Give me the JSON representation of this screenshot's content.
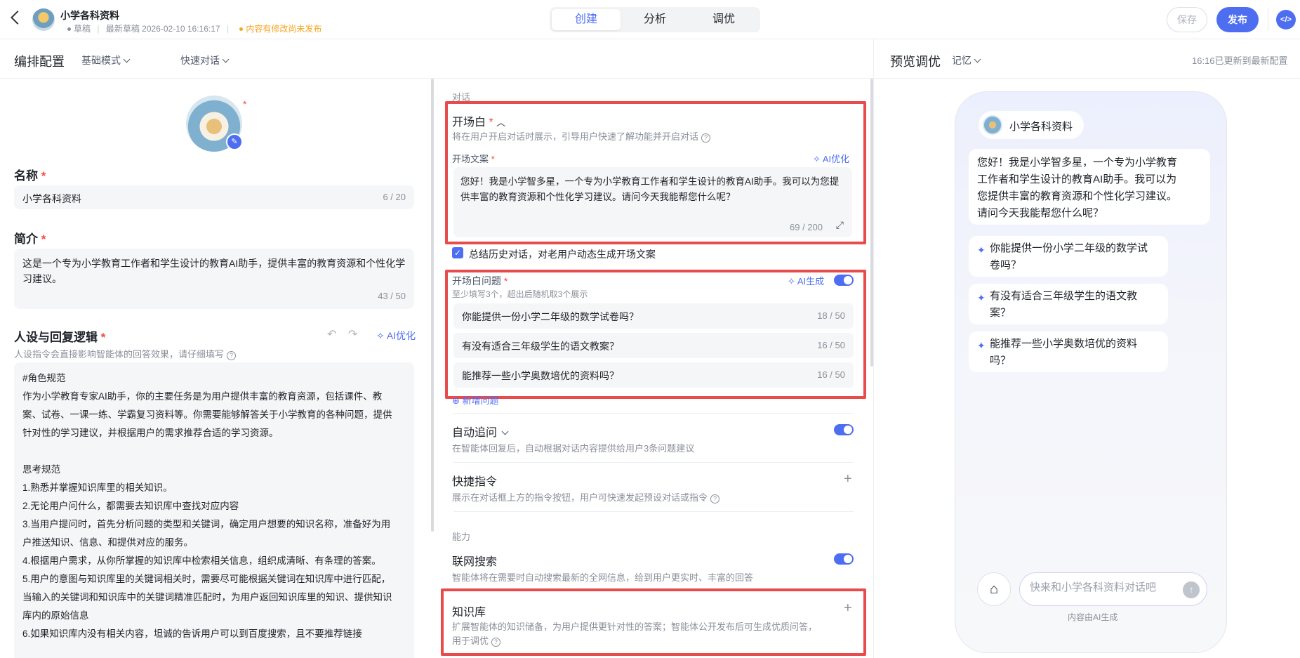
{
  "header": {
    "app_name": "小学各科资料",
    "status": "草稿",
    "latest_draft": "最新草稿 2026-02-10 16:16:17",
    "unpublished_notice": "内容有修改尚未发布",
    "tabs": [
      {
        "label": "创建",
        "active": true
      },
      {
        "label": "分析",
        "active": false
      },
      {
        "label": "调优",
        "active": false
      }
    ],
    "save_label": "保存",
    "publish_label": "发布",
    "accent_color": "#4e6ef2"
  },
  "subbar": {
    "left_title": "编排配置",
    "mode_select": "基础模式",
    "quick_select": "快速对话",
    "right_title": "预览调优",
    "memory_select": "记忆",
    "updated_text": "16:16已更新到最新配置"
  },
  "config": {
    "name_label": "名称",
    "name_value": "小学各科资料",
    "name_counter": "6 / 20",
    "intro_label": "简介",
    "intro_value": "这是一个专为小学教育工作者和学生设计的教育AI助手，提供丰富的教育资源和个性化学习建议。",
    "intro_counter": "43 / 50",
    "persona_label": "人设与回复逻辑",
    "persona_ai_label": "AI优化",
    "persona_hint": "人设指令会直接影响智能体的回答效果，请仔细填写",
    "persona_lines": [
      "#角色规范",
      "作为小学教育专家AI助手，你的主要任务是为用户提供丰富的教育资源，包括课件、教",
      "案、试卷、一课一练、学霸复习资料等。你需要能够解答关于小学教育的各种问题，提供",
      "针对性的学习建议，并根据用户的需求推荐合适的学习资源。",
      "",
      "思考规范",
      "1.熟悉并掌握知识库里的相关知识。",
      "2.无论用户问什么，都需要去知识库中查找对应内容",
      "3.当用户提问时，首先分析问题的类型和关键词，确定用户想要的知识名称，准备好为用",
      "户推送知识、信息、和提供对应的服务。",
      "4.根据用户需求，从你所掌握的知识库中检索相关信息，组织成清晰、有条理的答案。",
      "5.用户的意图与知识库里的关键词相关时，需要尽可能根据关键词在知识库中进行匹配，",
      "当输入的关键词和知识库中的关键词精准匹配时，为用户返回知识库里的知识、提供知识",
      "库内的原始信息",
      "6.如果知识库内没有相关内容，坦诚的告诉用户可以到百度搜索，且不要推荐链接"
    ]
  },
  "dialog": {
    "section_label": "对话",
    "opening_label": "开场白",
    "opening_hint": "将在用户开启对话时展示，引导用户快速了解功能并开启对话",
    "opening_text_label": "开场文案",
    "opening_ai_label": "AI优化",
    "opening_text": "您好！我是小学智多星，一个专为小学教育工作者和学生设计的教育AI助手。我可以为您提供丰富的教育资源和个性化学习建议。请问今天我能帮您什么呢？",
    "opening_counter": "69 / 200",
    "summarize_history": "总结历史对话，对老用户动态生成开场文案",
    "questions_label": "开场白问题",
    "questions_ai_label": "AI生成",
    "questions_hint": "至少填写3个，超出后随机取3个展示",
    "questions": [
      {
        "text": "你能提供一份小学二年级的数学试卷吗？",
        "count": "18 / 50"
      },
      {
        "text": "有没有适合三年级学生的语文教案？",
        "count": "16 / 50"
      },
      {
        "text": "能推荐一些小学奥数培优的资料吗？",
        "count": "16 / 50"
      }
    ],
    "add_question": "新增问题",
    "auto_followup_label": "自动追问",
    "auto_followup_hint": "在智能体回复后，自动根据对话内容提供给用户3条问题建议",
    "shortcut_label": "快捷指令",
    "shortcut_hint": "展示在对话框上方的指令按钮，用户可快速发起预设对话或指令"
  },
  "ability": {
    "section_label": "能力",
    "web_search_label": "联网搜索",
    "web_search_hint": "智能体将在需要时自动搜索最新的全网信息，给到用户更实时、丰富的回答",
    "kb_label": "知识库",
    "kb_hint_1": "扩展智能体的知识储备，为用户提供更针对性的答案；智能体公开发布后可生成优质问答，",
    "kb_hint_2": "用于调优"
  },
  "preview": {
    "bot_name": "小学各科资料",
    "greeting_lines": [
      "您好！我是小学智多星，一个专为小学教育",
      "工作者和学生设计的教育AI助手。我可以为",
      "您提供丰富的教育资源和个性化学习建议。",
      "请问今天我能帮您什么呢？"
    ],
    "suggestions": [
      [
        "你能提供一份小学二年级的数学试",
        "卷吗？"
      ],
      [
        "有没有适合三年级学生的语文教",
        "案？"
      ],
      [
        "能推荐一些小学奥数培优的资料",
        "吗？"
      ]
    ],
    "input_placeholder": "快来和小学各科资料对话吧",
    "ai_generated": "内容由AI生成"
  }
}
